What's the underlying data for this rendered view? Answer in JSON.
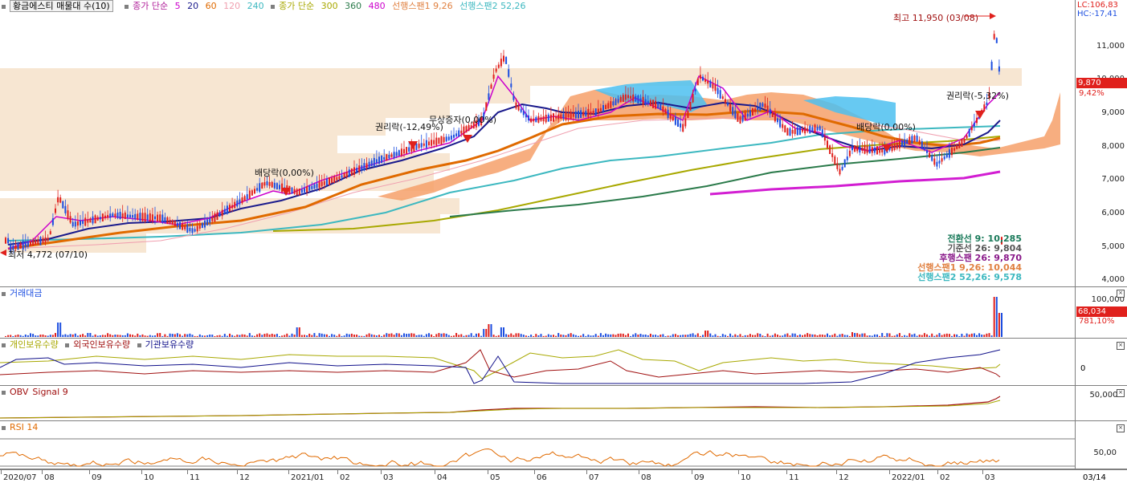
{
  "main": {
    "title": "황금에스티 매물대 수(10)",
    "legend1": {
      "prefix": "종가 단순",
      "periods": [
        "5",
        "20",
        "60",
        "120",
        "240"
      ],
      "colors": [
        "#cc00cc",
        "#1a1a8c",
        "#e06a00",
        "#f0a0b0",
        "#3cb8c0"
      ]
    },
    "legend2": {
      "prefix": "종가 단순",
      "periods": [
        "300",
        "360",
        "480"
      ],
      "colors": [
        "#a8a800",
        "#2a7a4a",
        "#cc00cc"
      ]
    },
    "legend3": [
      {
        "text": "선행스팬1 9,26",
        "color": "#e08040"
      },
      {
        "text": "선행스팬2 52,26",
        "color": "#3cb8c0"
      }
    ],
    "y_ticks": [
      "11,000",
      "10,000",
      "9,000",
      "8,000",
      "7,000",
      "6,000",
      "5,000",
      "4,000"
    ],
    "lc": "LC:106,83",
    "hc": "HC:-17,41",
    "price_box": "9,870",
    "price_pct": "9,42%",
    "annotations": {
      "high": "최고 11,950 (03/08)",
      "low": "최저 4,772 (07/10)",
      "ex_rights1": "권리락(-12,49%)",
      "bonus_issue": "무상증자(0,00%)",
      "dividend1": "배당락(0,00%)",
      "dividend2": "배당락(0,00%)",
      "ex_rights2": "권리락(-5,32%)"
    },
    "ichimoku": [
      {
        "text": "전환선 9: 10,285",
        "color": "#1a7a5a"
      },
      {
        "text": "기준선 26: 9,804",
        "color": "#555555"
      },
      {
        "text": "후행스팬 26: 9,870",
        "color": "#8a1a8a"
      },
      {
        "text": "선행스팬1 9,26: 10,044",
        "color": "#e08040"
      },
      {
        "text": "선행스팬2 52,26: 9,578",
        "color": "#3cb8c0"
      }
    ]
  },
  "volume": {
    "title": "거래대금",
    "tick": "100,000",
    "box": "68,034",
    "pct": "781,10%"
  },
  "holders": {
    "series": [
      {
        "text": "개인보유수량",
        "color": "#a8a800"
      },
      {
        "text": "외국인보유수량",
        "color": "#a01010"
      },
      {
        "text": "기관보유수량",
        "color": "#10108a"
      }
    ],
    "tick": "0"
  },
  "obv": {
    "title": "OBV",
    "signal": "Signal 9",
    "tick": "50,000K"
  },
  "rsi": {
    "title": "RSI 14",
    "tick": "50,00"
  },
  "xaxis": [
    "2020/07",
    "08",
    "09",
    "10",
    "11",
    "12",
    "2021/01",
    "02",
    "03",
    "04",
    "05",
    "06",
    "07",
    "08",
    "09",
    "10",
    "11",
    "12",
    "2022/01",
    "02",
    "03"
  ],
  "xaxis_end": "03/14",
  "colors": {
    "up": "#e0201c",
    "down": "#1c4ee0",
    "volume_profile": "#f7e9d8"
  }
}
